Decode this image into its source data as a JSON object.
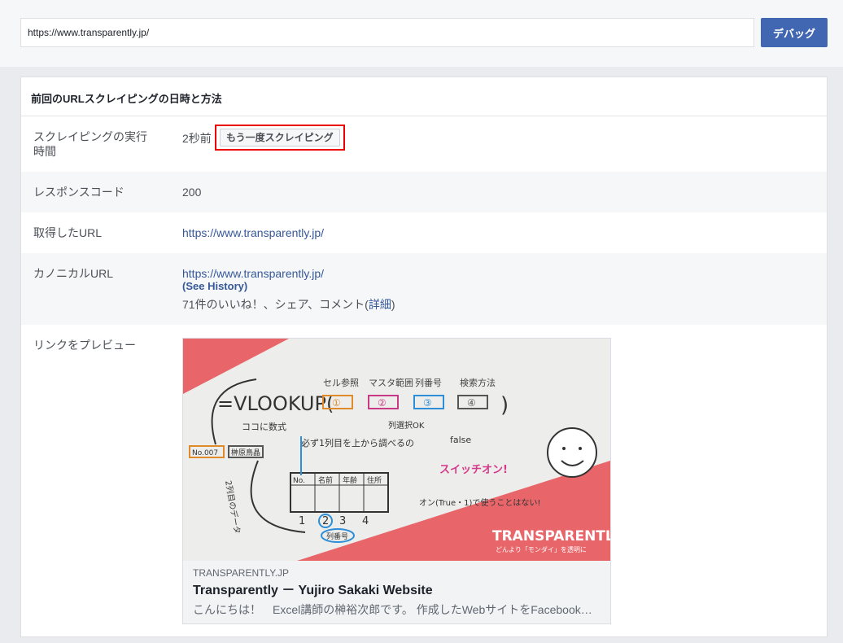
{
  "search": {
    "url_value": "https://www.transparently.jp/",
    "debug_label": "デバッグ"
  },
  "panel": {
    "title": "前回のURLスクレイピングの日時と方法"
  },
  "rows": {
    "scrape_time": {
      "label": "スクレイピングの実行時間",
      "value": "2秒前",
      "rescrape_label": "もう一度スクレイピング"
    },
    "response_code": {
      "label": "レスポンスコード",
      "value": "200"
    },
    "fetched_url": {
      "label": "取得したURL",
      "value": "https://www.transparently.jp/"
    },
    "canonical_url": {
      "label": "カノニカルURL",
      "value": "https://www.transparently.jp/",
      "history_label": "(See History)",
      "engagement_prefix": "71件のいいね！、シェア、コメント(",
      "engagement_link": "詳細",
      "engagement_suffix": ")"
    },
    "link_preview": {
      "label": "リンクをプレビュー"
    }
  },
  "preview": {
    "domain": "TRANSPARENTLY.JP",
    "title": "Transparently － Yujiro Sakaki Website",
    "description": "こんにちは！　Excel講師の榊裕次郎です。 作成したWebサイトをFacebook…",
    "image": {
      "brand": "TRANSPARENTLY",
      "tagline": "どんより「モンダイ」を透明に",
      "formula": "=VLOOKUP(",
      "args": [
        "セル参照",
        "マスタ範囲",
        "列番号",
        "検索方法"
      ],
      "arg_numbers": [
        "①",
        "②",
        "③",
        "④"
      ],
      "note_here_formula": "ココに数式",
      "note_col_select": "列選択OK",
      "note_first_col": "必ず1列目を上から調べるの",
      "note_switch": "スイッチオン!",
      "note_false": "false",
      "note_true_unused": "オン(True・1)で使うことはない!",
      "note_col_num": "列番号",
      "note_left_col": "2列目のデータ",
      "cell_no": "No.007",
      "cell_name": "榊原鳥晶",
      "table_headers": [
        "No.",
        "名前",
        "年齢",
        "住所"
      ],
      "col_numbers": [
        "1",
        "2",
        "3",
        "4"
      ],
      "brand_color": "#e8666a"
    },
    "colors": {
      "accent": "#4267b2",
      "link": "#365899",
      "highlight": "#e00000"
    }
  }
}
